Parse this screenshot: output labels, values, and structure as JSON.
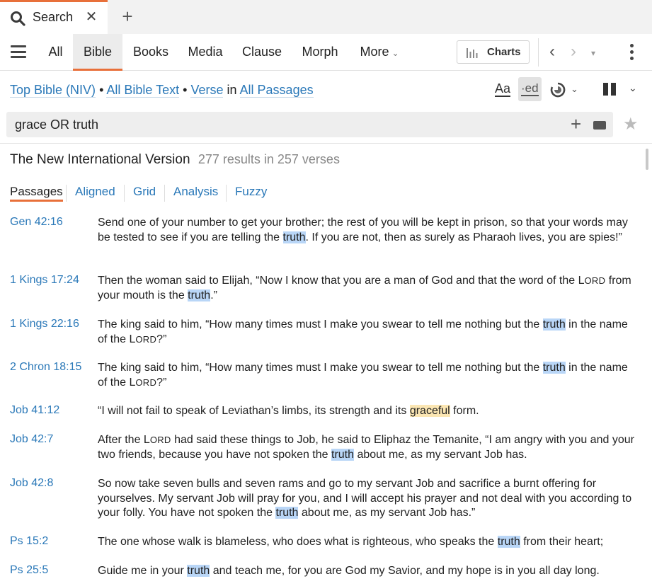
{
  "tab": {
    "title": "Search",
    "icon": "search-icon",
    "close_icon": "close-icon",
    "new_tab_icon": "plus-icon"
  },
  "toolbar": {
    "tabs": [
      "All",
      "Bible",
      "Books",
      "Media",
      "Clause",
      "Morph",
      "More"
    ],
    "active_tab": "Bible",
    "charts_label": "Charts"
  },
  "scope": {
    "bible": "Top Bible (NIV)",
    "sep1": "•",
    "text": "All Bible Text",
    "sep2": "•",
    "unit": "Verse",
    "in": "in",
    "passages": "All Passages"
  },
  "tools": {
    "aa": "Aa",
    "ed": "·ed"
  },
  "search": {
    "query": "grace OR truth"
  },
  "results": {
    "title": "The New International Version",
    "count": "277 results in 257 verses"
  },
  "subtabs": [
    "Passages",
    "Aligned",
    "Grid",
    "Analysis",
    "Fuzzy"
  ],
  "active_subtab": "Passages",
  "verses": [
    {
      "ref": "Gen 42:16",
      "segments": [
        {
          "t": "Send one of your number to get your brother; the rest of you will be kept in prison, so that your words may be tested to see if you are telling the "
        },
        {
          "t": "truth",
          "h": "hit"
        },
        {
          "t": ". If you are not, then as surely as Pharaoh lives, you are spies!”"
        }
      ]
    },
    {
      "ref": "1 Kings 17:24",
      "segments": [
        {
          "t": "Then the woman said to Elijah, “Now I know that you are a man of God and that the word of the L"
        },
        {
          "t": "ORD",
          "h": "sc"
        },
        {
          "t": " from your mouth is the "
        },
        {
          "t": "truth",
          "h": "hit"
        },
        {
          "t": ".”"
        }
      ]
    },
    {
      "ref": "1 Kings 22:16",
      "segments": [
        {
          "t": "The king said to him, “How many times must I make you swear to tell me nothing but the "
        },
        {
          "t": "truth",
          "h": "hit"
        },
        {
          "t": " in the name of the L"
        },
        {
          "t": "ORD",
          "h": "sc"
        },
        {
          "t": "?”"
        }
      ]
    },
    {
      "ref": "2 Chron 18:15",
      "segments": [
        {
          "t": "The king said to him, “How many times must I make you swear to tell me nothing but the "
        },
        {
          "t": "truth",
          "h": "hit"
        },
        {
          "t": " in the name of the L"
        },
        {
          "t": "ORD",
          "h": "sc"
        },
        {
          "t": "?”"
        }
      ]
    },
    {
      "ref": "Job 41:12",
      "segments": [
        {
          "t": "“I will not fail to speak of Leviathan’s limbs, its strength and its "
        },
        {
          "t": "graceful",
          "h": "hit2"
        },
        {
          "t": " form."
        }
      ]
    },
    {
      "ref": "Job 42:7",
      "segments": [
        {
          "t": "After the L"
        },
        {
          "t": "ORD",
          "h": "sc"
        },
        {
          "t": " had said these things to Job, he said to Eliphaz the Temanite, “I am angry with you and your two friends, because you have not spoken the "
        },
        {
          "t": "truth",
          "h": "hit"
        },
        {
          "t": " about me, as my servant Job has."
        }
      ]
    },
    {
      "ref": "Job 42:8",
      "segments": [
        {
          "t": "So now take seven bulls and seven rams and go to my servant Job and sacrifice a burnt offering for yourselves. My servant Job will pray for you, and I will accept his prayer and not deal with you according to your folly. You have not spoken the "
        },
        {
          "t": "truth",
          "h": "hit"
        },
        {
          "t": " about me, as my servant Job has.”"
        }
      ]
    },
    {
      "ref": "Ps 15:2",
      "segments": [
        {
          "t": "The one whose walk is blameless, who does what is righteous, who speaks the "
        },
        {
          "t": "truth",
          "h": "hit"
        },
        {
          "t": " from their heart;"
        }
      ]
    },
    {
      "ref": "Ps 25:5",
      "segments": [
        {
          "t": "Guide me in your "
        },
        {
          "t": "truth",
          "h": "hit"
        },
        {
          "t": " and teach me, for you are God my Savior, and my hope is in you all day long."
        }
      ]
    }
  ]
}
